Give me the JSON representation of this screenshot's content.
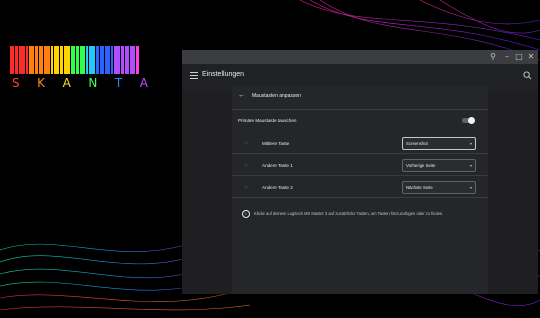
{
  "logo": {
    "text": [
      "S",
      "K",
      "A",
      "N",
      "T",
      "A"
    ],
    "text_colors": [
      "#ff3b3b",
      "#ff8a1f",
      "#ffe11a",
      "#3dff5a",
      "#2f7bff",
      "#c04bff"
    ],
    "bar_colors": [
      "#ff2a2a",
      "#ff2a2a",
      "#ff7f11",
      "#ff7f11",
      "#ffd400",
      "#ffd400",
      "#30ff4d",
      "#30ff4d",
      "#25c7ff",
      "#2b63ff",
      "#2b63ff",
      "#b14cff",
      "#b14cff",
      "#ff3fd8"
    ]
  },
  "titlebar": {
    "icons": [
      "search-icon",
      "minimize-icon",
      "maximize-icon",
      "close-icon"
    ]
  },
  "appbar": {
    "title": "Einstellungen"
  },
  "panel": {
    "title": "Maustasten anpassen",
    "swap_label": "Primäre Maustaste tauschen",
    "swap_enabled": false,
    "rows": [
      {
        "label": "Mittlere Taste",
        "value": "Screenshot"
      },
      {
        "label": "Andere Taste 1",
        "value": "Vorherige Seite"
      },
      {
        "label": "Andere Taste 2",
        "value": "Nächste Seite"
      }
    ],
    "info": "Klicke auf deinem Logitech MX Master 3 auf zusätzliche Tasten, um Tasten hinzuzufügen oder zu finden."
  }
}
